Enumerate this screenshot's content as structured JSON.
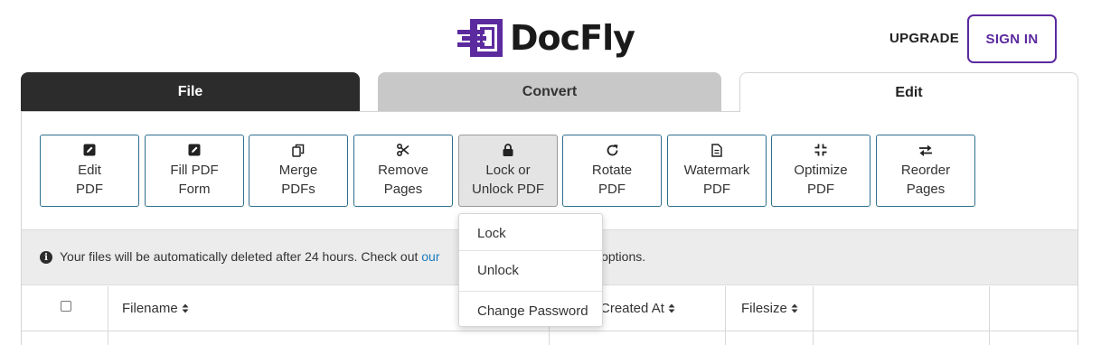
{
  "header": {
    "logo_text": "DocFly",
    "upgrade_label": "UPGRADE",
    "signin_label": "SIGN IN"
  },
  "tabs": [
    {
      "label": "File"
    },
    {
      "label": "Convert"
    },
    {
      "label": "Edit"
    }
  ],
  "tools": [
    {
      "label": "Edit\nPDF",
      "icon": "edit-icon"
    },
    {
      "label": "Fill PDF\nForm",
      "icon": "form-edit-icon"
    },
    {
      "label": "Merge\nPDFs",
      "icon": "copy-icon"
    },
    {
      "label": "Remove\nPages",
      "icon": "scissors-icon"
    },
    {
      "label": "Lock or\nUnlock PDF",
      "icon": "lock-icon"
    },
    {
      "label": "Rotate\nPDF",
      "icon": "rotate-icon"
    },
    {
      "label": "Watermark\nPDF",
      "icon": "document-icon"
    },
    {
      "label": "Optimize\nPDF",
      "icon": "compress-icon"
    },
    {
      "label": "Reorder\nPages",
      "icon": "swap-arrows-icon"
    }
  ],
  "notice": {
    "text_before": "Your files will be automatically deleted after 24 hours. Check out ",
    "link_text": "our",
    "text_after": "storage options."
  },
  "table": {
    "headers": {
      "filename": "Filename",
      "created_at": "Created At",
      "filesize": "Filesize"
    }
  },
  "dropdown": {
    "items": [
      "Lock",
      "Unlock",
      "Change Password"
    ]
  },
  "colors": {
    "brand_purple": "#5b2a9e",
    "tab_dark": "#2c2c2c",
    "tool_border": "#2e6f8e",
    "link_blue": "#1a7bbd"
  }
}
